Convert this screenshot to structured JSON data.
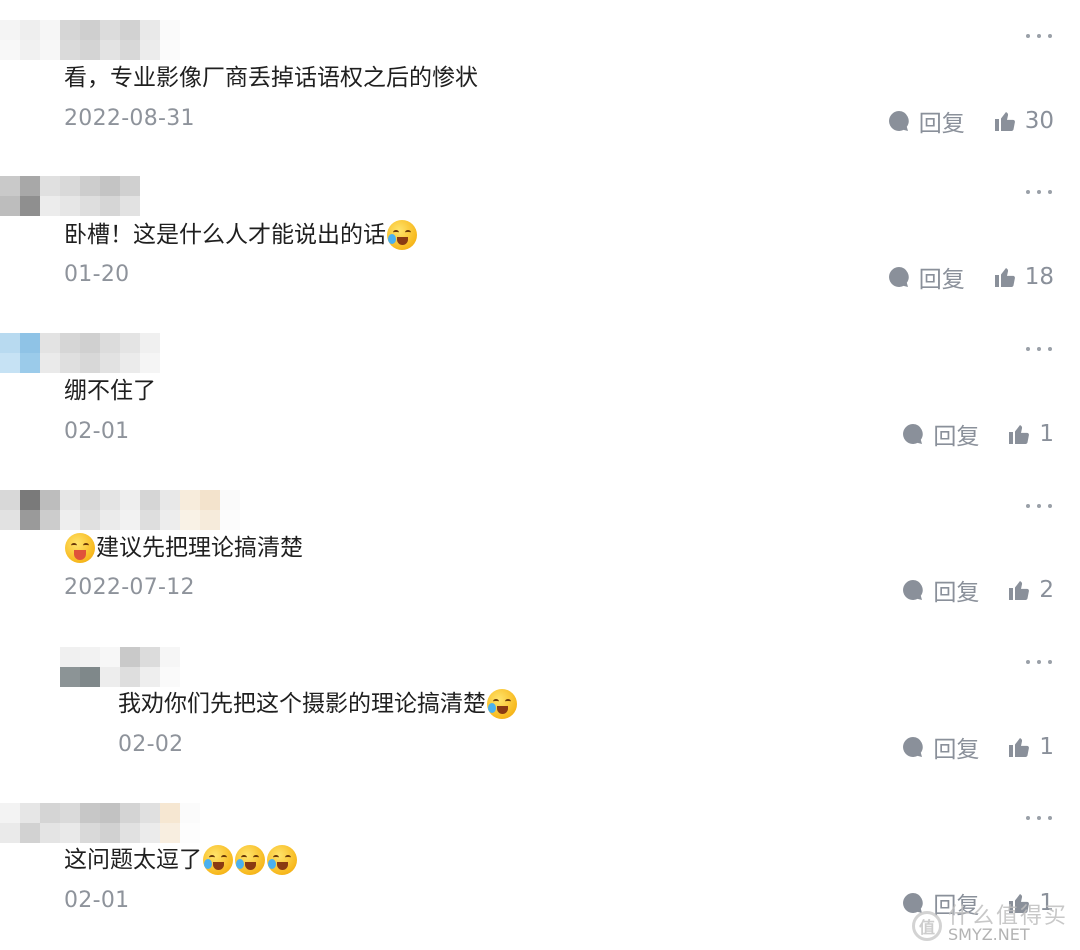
{
  "actions": {
    "reply_label": "回复"
  },
  "comments": [
    {
      "text": "看，专业影像厂商丢掉话语权之后的惨状",
      "date": "2022-08-31",
      "likes": "30"
    },
    {
      "text": "卧槽！这是什么人才能说出的话",
      "date": "01-20",
      "likes": "18"
    },
    {
      "text": "绷不住了",
      "date": "02-01",
      "likes": "1"
    },
    {
      "text": "建议先把理论搞清楚",
      "date": "2022-07-12",
      "likes": "2"
    },
    {
      "text": "我劝你们先把这个摄影的理论搞清楚",
      "date": "02-02",
      "likes": "1"
    },
    {
      "text": "这问题太逗了",
      "date": "02-01",
      "likes": "1"
    }
  ],
  "icons": {
    "more": "more-dots-icon",
    "reply": "reply-bubble-icon",
    "like": "thumbs-up-icon",
    "emoji_laugh": "laugh-cry-emoji",
    "emoji_drool": "drool-emoji"
  },
  "watermark": {
    "cn": "什么值得买",
    "en": "SMYZ.NET",
    "logo": "值"
  },
  "colors": {
    "meta_text": "#8e939b",
    "body_text": "#1f1f1f",
    "icon": "#9aa0a8"
  }
}
